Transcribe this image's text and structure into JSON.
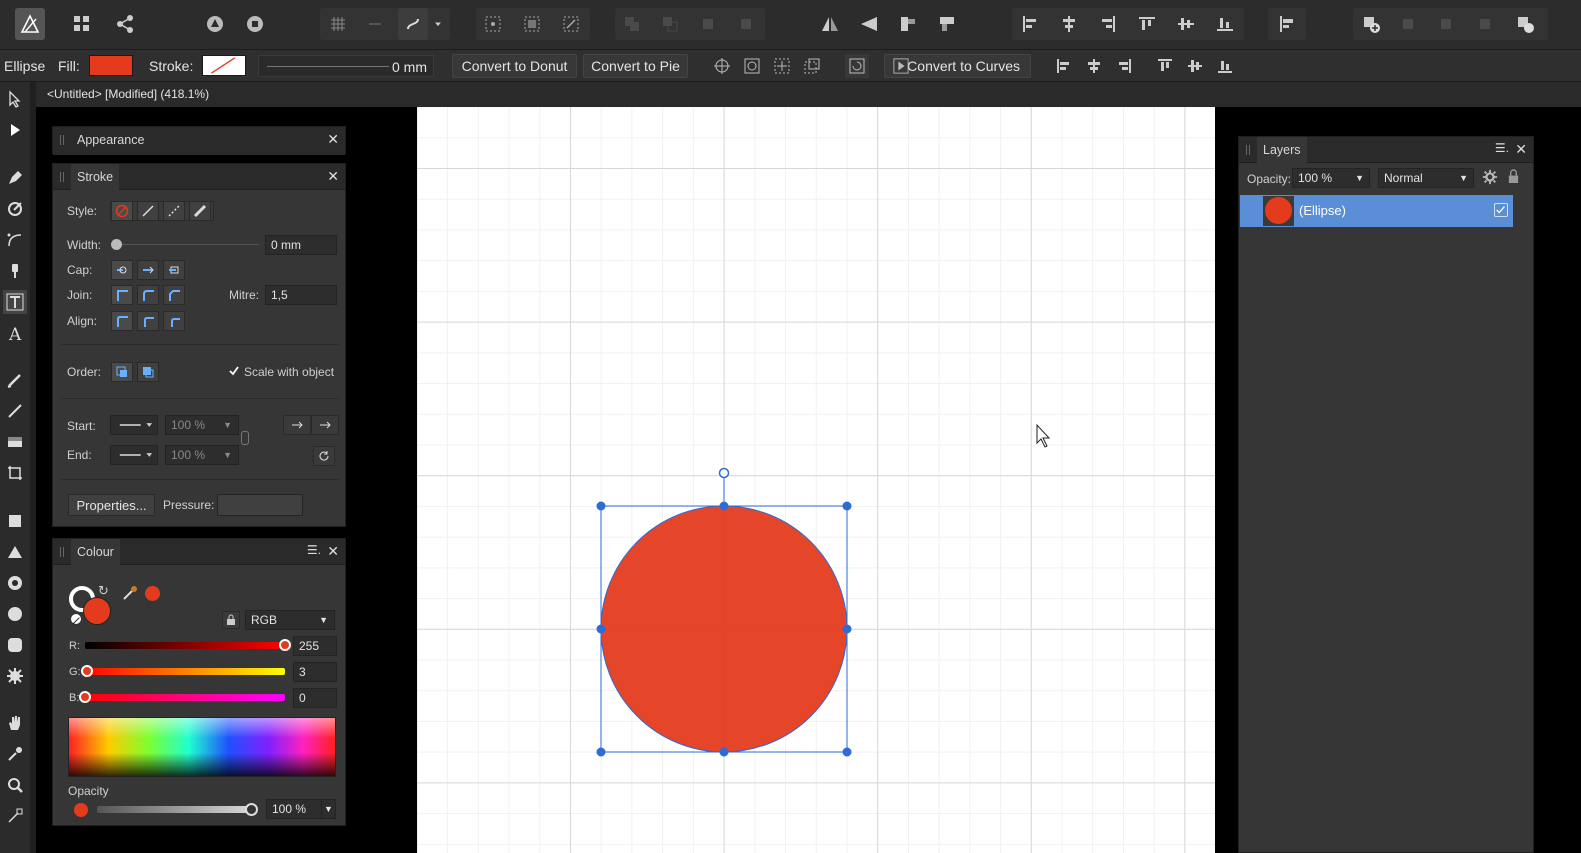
{
  "toolbar": {
    "icons": [
      "affinity-logo-icon",
      "studio-grid-icon",
      "share-icon",
      "persona-designer-icon",
      "persona-pixel-icon",
      "snap-grid-icon",
      "snap-icon",
      "force-pixel-icon",
      "transform-origin-icon",
      "select-all-icon",
      "select-bounds-icon",
      "select-shape-icon",
      "boolean-add-icon",
      "boolean-subtract-icon",
      "boolean-intersect-icon",
      "boolean-xor-icon",
      "flip-horizontal-icon",
      "flip-vertical-icon",
      "rotate-left-icon",
      "rotate-right-icon",
      "align-left-icon",
      "align-center-icon",
      "align-right-icon",
      "align-top-icon",
      "align-middle-icon",
      "align-bottom-icon",
      "distribute-icon",
      "insert-icon",
      "arrange-1-icon",
      "arrange-2-icon",
      "arrange-3-icon",
      "arrange-4-icon"
    ]
  },
  "context": {
    "shape_name": "Ellipse",
    "fill_label": "Fill:",
    "stroke_label": "Stroke:",
    "fill_color": "#e43b1c",
    "width_value": "0 mm",
    "convert_donut": "Convert to Donut",
    "convert_pie": "Convert to Pie",
    "convert_curves": "Convert to Curves"
  },
  "doc": {
    "title": "<Untitled> [Modified] (418.1%)"
  },
  "appearance": {
    "title": "Appearance"
  },
  "stroke": {
    "title": "Stroke",
    "style_label": "Style:",
    "width_label": "Width:",
    "width_value": "0 mm",
    "cap_label": "Cap:",
    "join_label": "Join:",
    "mitre_label": "Mitre:",
    "mitre_value": "1,5",
    "align_label": "Align:",
    "order_label": "Order:",
    "scale_label": "Scale with object",
    "start_label": "Start:",
    "end_label": "End:",
    "start_pct": "100 %",
    "end_pct": "100 %",
    "properties_btn": "Properties...",
    "pressure_label": "Pressure:"
  },
  "colour": {
    "title": "Colour",
    "mode": "RGB",
    "r_label": "R:",
    "g_label": "G:",
    "b_label": "B:",
    "r_value": "255",
    "g_value": "3",
    "b_value": "0",
    "r_level": 1.0,
    "g_level": 0.012,
    "b_level": 0.0,
    "opacity_label": "Opacity",
    "opacity_value": "100 %",
    "swatch_color": "#e43b1c"
  },
  "layers": {
    "title": "Layers",
    "opacity_label": "Opacity:",
    "opacity_value": "100 %",
    "blend_mode": "Normal",
    "items": [
      {
        "name": "(Ellipse)",
        "color": "#e43b1c",
        "visible": true
      }
    ]
  }
}
